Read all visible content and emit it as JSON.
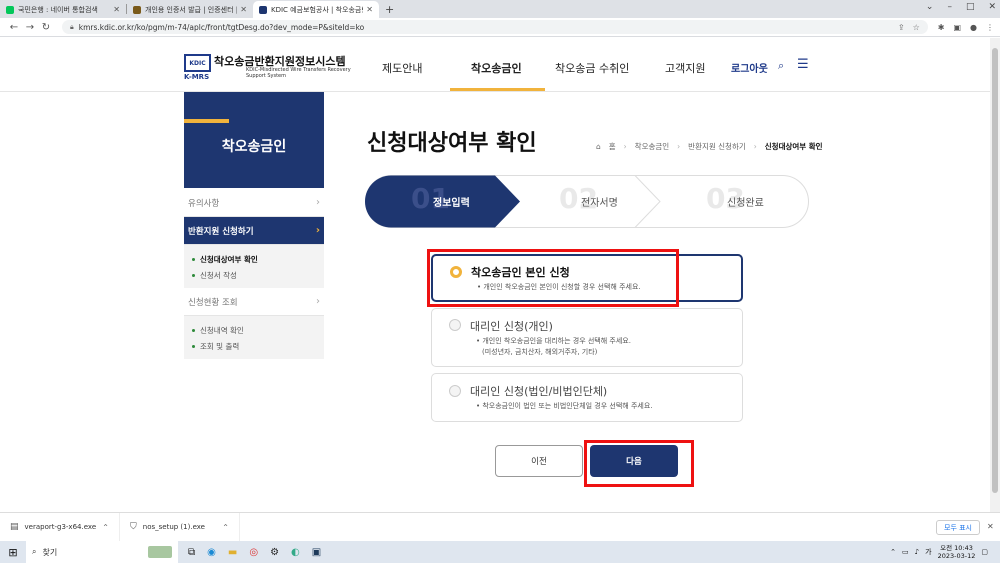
{
  "browser": {
    "tabs": [
      {
        "title": "국민은행 : 네이버 통합검색",
        "favicon_color": "#03c75a",
        "active": false
      },
      {
        "title": "개인용 인증서 발급 | 인증센터 |",
        "favicon_color": "#7a5a1a",
        "active": false
      },
      {
        "title": "KDIC 예금보험공사 | 착오송금반",
        "favicon_color": "#1e3670",
        "active": true
      }
    ],
    "url": "kmrs.kdic.or.kr/ko/pgm/m-74/aplc/front/tgtDesg.do?dev_mode=P&siteId=ko"
  },
  "header": {
    "logo_badge": "KDIC",
    "logo_sub": "K-MRS",
    "logo_title": "착오송금반환지원정보시스템",
    "logo_en": "KDIC-Misdirected Wire Transfers Recovery Support System",
    "nav": [
      "제도안내",
      "착오송금인",
      "착오송금 수취인",
      "고객지원"
    ],
    "logout": "로그아웃"
  },
  "sidebar": {
    "title": "착오송금인",
    "items": [
      {
        "label": "유의사항"
      },
      {
        "label": "반환지원 신청하기"
      },
      {
        "label": "신청현황 조회"
      }
    ],
    "sub1": [
      "신청대상여부 확인",
      "신청서 작성"
    ],
    "sub2": [
      "신청내역 확인",
      "조회 및 출력"
    ]
  },
  "main": {
    "title": "신청대상여부 확인",
    "breadcrumb": [
      "홈",
      "착오송금인",
      "반환지원 신청하기",
      "신청대상여부 확인"
    ],
    "steps": [
      {
        "num": "01",
        "label": "정보입력"
      },
      {
        "num": "02",
        "label": "전자서명"
      },
      {
        "num": "03",
        "label": "신청완료"
      }
    ],
    "options": [
      {
        "title": "착오송금인 본인 신청",
        "desc1": "• 개인인 착오송금인 본인이 신청할 경우 선택해 주세요.",
        "desc2": ""
      },
      {
        "title": "대리인 신청(개인)",
        "desc1": "• 개인인 착오송금인을 대리하는 경우 선택해 주세요.",
        "desc2": "(미성년자, 금치산자, 해외거주자, 기타)"
      },
      {
        "title": "대리인 신청(법인/비법인단체)",
        "desc1": "• 착오송금인이 법인 또는 비법인단체일 경우 선택해 주세요.",
        "desc2": ""
      }
    ],
    "prev_label": "이전",
    "next_label": "다음"
  },
  "downloads": {
    "items": [
      "veraport-g3-x64.exe",
      "nos_setup (1).exe"
    ],
    "show_all": "모두 표시"
  },
  "taskbar": {
    "search_placeholder": "찾기",
    "time": "오전 10:43",
    "date": "2023-03-12"
  },
  "colors": {
    "brand_navy": "#1e3670",
    "accent_yellow": "#f1b33c",
    "highlight_red": "#e11111"
  }
}
